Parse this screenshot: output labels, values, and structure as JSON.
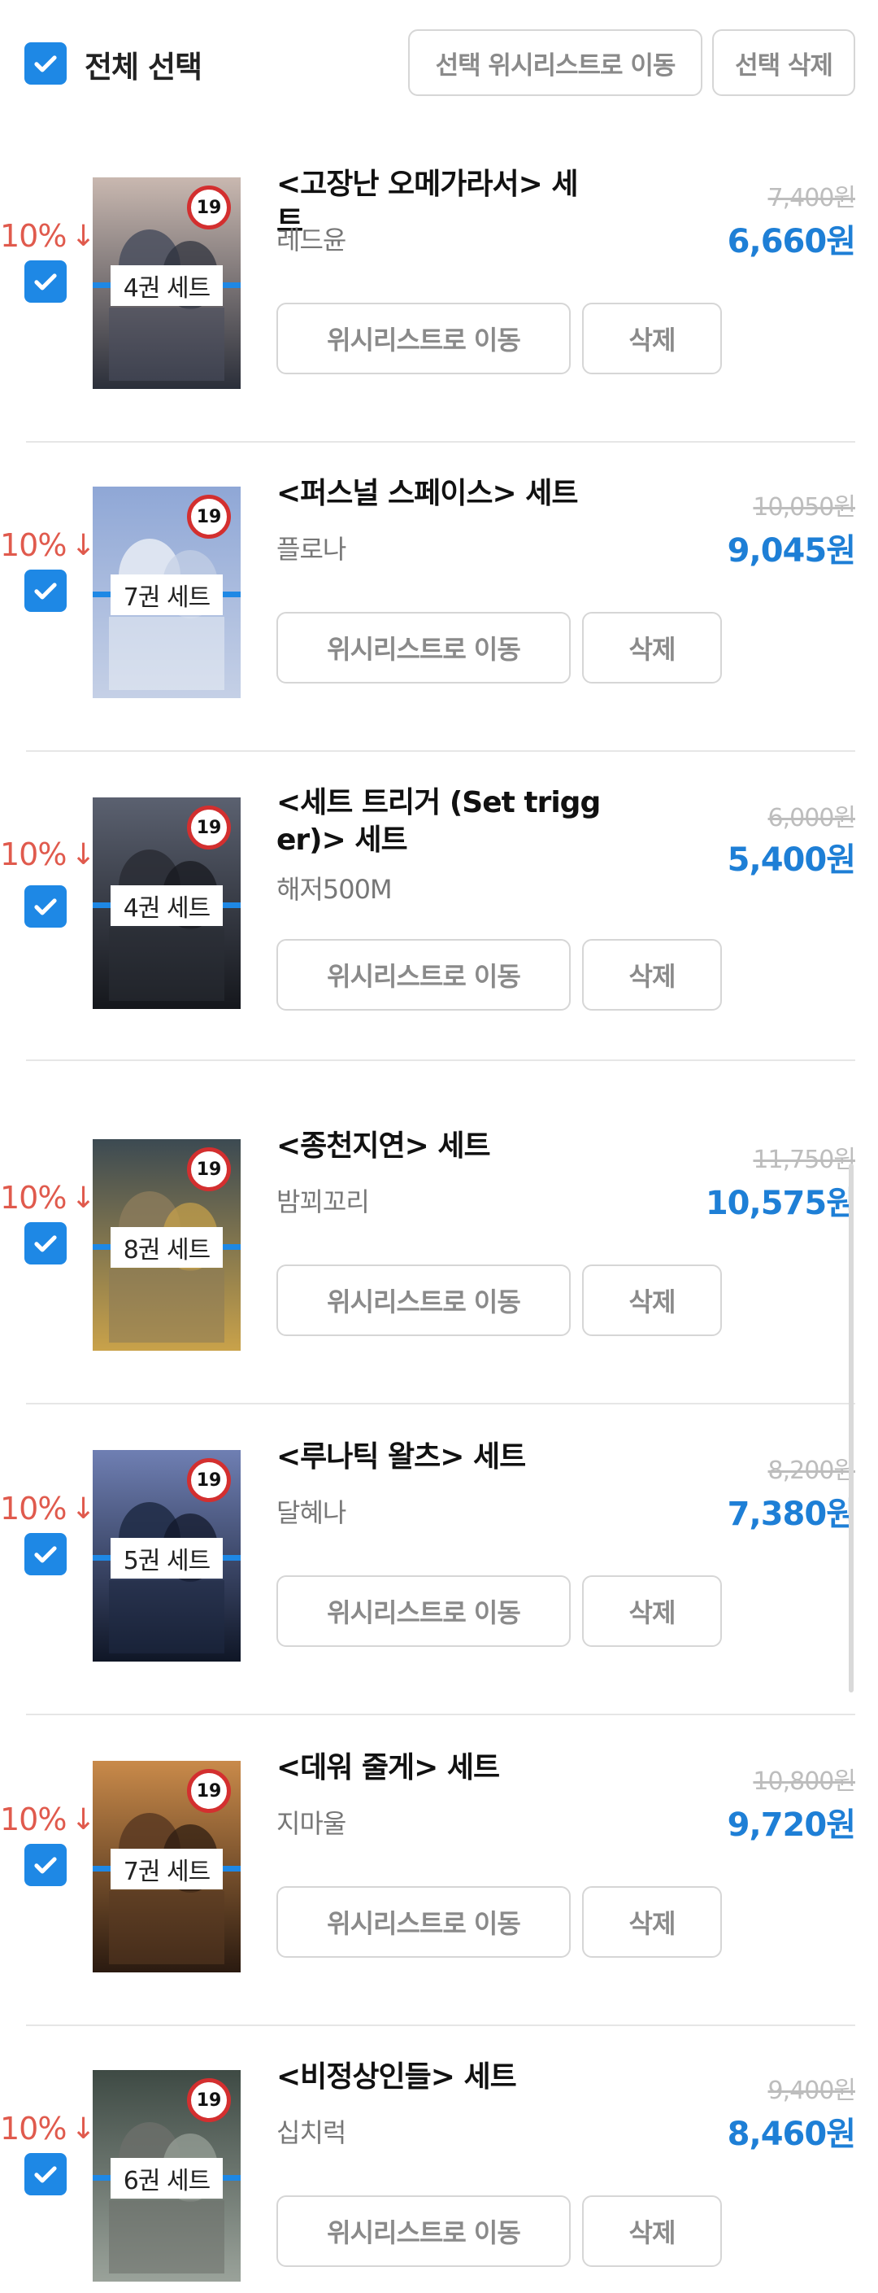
{
  "header": {
    "select_all_label": "전체 선택",
    "move_selected_label": "선택 위시리스트로 이동",
    "delete_selected_label": "선택 삭제",
    "select_all_checked": true
  },
  "item_buttons": {
    "move_label": "위시리스트로 이동",
    "delete_label": "삭제"
  },
  "colors": {
    "accent": "#1e88e5",
    "discount": "#e05a4d",
    "price": "#1e7fd6"
  },
  "items": [
    {
      "title": "<고장난 오메가라서> 세트",
      "author": "레드윤",
      "volumes": "4권 세트",
      "age": "19",
      "original_price": "7,400원",
      "discount": "10%",
      "price": "6,660원",
      "checked": true
    },
    {
      "title": "<퍼스널 스페이스> 세트",
      "author": "플로나",
      "volumes": "7권 세트",
      "age": "19",
      "original_price": "10,050원",
      "discount": "10%",
      "price": "9,045원",
      "checked": true
    },
    {
      "title": "<세트 트리거 (Set trigger)> 세트",
      "author": "해저500M",
      "volumes": "4권 세트",
      "age": "19",
      "original_price": "6,000원",
      "discount": "10%",
      "price": "5,400원",
      "checked": true
    },
    {
      "title": "<종천지연> 세트",
      "author": "밤꾀꼬리",
      "volumes": "8권 세트",
      "age": "19",
      "original_price": "11,750원",
      "discount": "10%",
      "price": "10,575원",
      "checked": true
    },
    {
      "title": "<루나틱 왈츠> 세트",
      "author": "달혜나",
      "volumes": "5권 세트",
      "age": "19",
      "original_price": "8,200원",
      "discount": "10%",
      "price": "7,380원",
      "checked": true
    },
    {
      "title": "<데워 줄게> 세트",
      "author": "지마울",
      "volumes": "7권 세트",
      "age": "19",
      "original_price": "10,800원",
      "discount": "10%",
      "price": "9,720원",
      "checked": true
    },
    {
      "title": "<비정상인들> 세트",
      "author": "십치럭",
      "volumes": "6권 세트",
      "age": "19",
      "original_price": "9,400원",
      "discount": "10%",
      "price": "8,460원",
      "checked": true
    }
  ]
}
